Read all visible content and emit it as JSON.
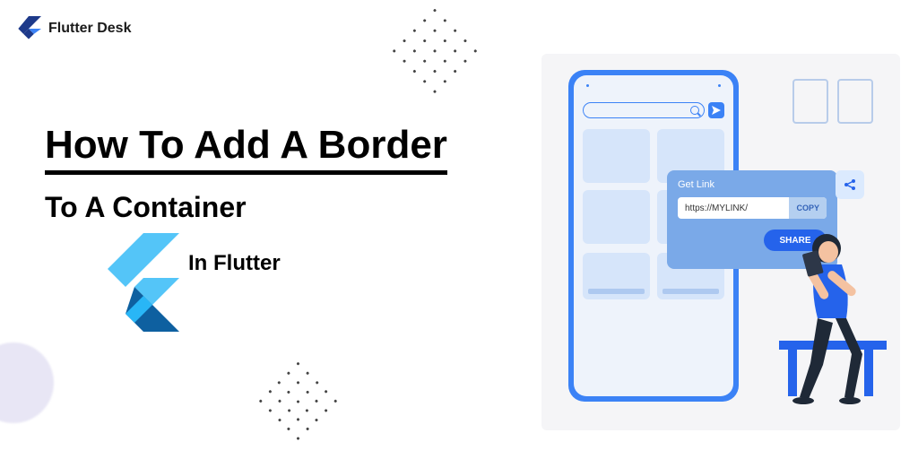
{
  "brand": "Flutter Desk",
  "title": {
    "line1": "How To Add A Border",
    "line2": "To A Container",
    "line3": "In Flutter"
  },
  "illustration": {
    "dialog_title": "Get Link",
    "url": "https://MYLINK/",
    "copy_label": "COPY",
    "share_label": "SHARE"
  }
}
